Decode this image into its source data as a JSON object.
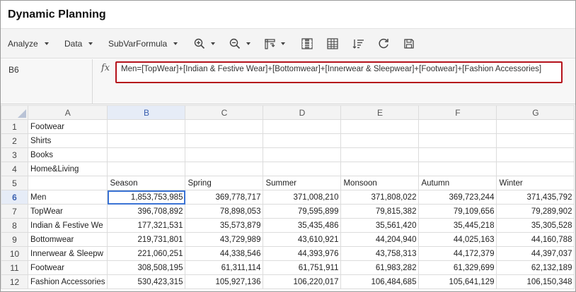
{
  "app": {
    "title": "Dynamic Planning"
  },
  "toolbar": {
    "analyze": "Analyze",
    "data": "Data",
    "subvarformula": "SubVarFormula"
  },
  "formula_bar": {
    "cell_ref": "B6",
    "fx": "fx",
    "formula": "Men=[TopWear]+[Indian & Festive Wear]+[Bottomwear]+[Innerwear & Sleepwear]+[Footwear]+[Fashion Accessories]"
  },
  "grid": {
    "columns": [
      "A",
      "B",
      "C",
      "D",
      "E",
      "F",
      "G"
    ],
    "rows": [
      {
        "num": "1",
        "cells": [
          "Footwear",
          "",
          "",
          "",
          "",
          "",
          ""
        ]
      },
      {
        "num": "2",
        "cells": [
          "Shirts",
          "",
          "",
          "",
          "",
          "",
          ""
        ]
      },
      {
        "num": "3",
        "cells": [
          "Books",
          "",
          "",
          "",
          "",
          "",
          ""
        ]
      },
      {
        "num": "4",
        "cells": [
          "Home&Living",
          "",
          "",
          "",
          "",
          "",
          ""
        ]
      },
      {
        "num": "5",
        "cells": [
          "",
          "Season",
          "Spring",
          "Summer",
          "Monsoon",
          "Autumn",
          "Winter"
        ]
      },
      {
        "num": "6",
        "cells": [
          "Men",
          "1,853,753,985",
          "369,778,717",
          "371,008,210",
          "371,808,022",
          "369,723,244",
          "371,435,792"
        ]
      },
      {
        "num": "7",
        "cells": [
          "TopWear",
          "396,708,892",
          "78,898,053",
          "79,595,899",
          "79,815,382",
          "79,109,656",
          "79,289,902"
        ]
      },
      {
        "num": "8",
        "cells": [
          "Indian & Festive We",
          "177,321,531",
          "35,573,879",
          "35,435,486",
          "35,561,420",
          "35,445,218",
          "35,305,528"
        ]
      },
      {
        "num": "9",
        "cells": [
          "Bottomwear",
          "219,731,801",
          "43,729,989",
          "43,610,921",
          "44,204,940",
          "44,025,163",
          "44,160,788"
        ]
      },
      {
        "num": "10",
        "cells": [
          "Innerwear & Sleepw",
          "221,060,251",
          "44,338,546",
          "44,393,976",
          "43,758,313",
          "44,172,379",
          "44,397,037"
        ]
      },
      {
        "num": "11",
        "cells": [
          "Footwear",
          "308,508,195",
          "61,311,114",
          "61,751,911",
          "61,983,282",
          "61,329,699",
          "62,132,189"
        ]
      },
      {
        "num": "12",
        "cells": [
          "Fashion Accessories",
          "530,423,315",
          "105,927,136",
          "106,220,017",
          "106,484,685",
          "105,641,129",
          "106,150,348"
        ]
      }
    ]
  }
}
